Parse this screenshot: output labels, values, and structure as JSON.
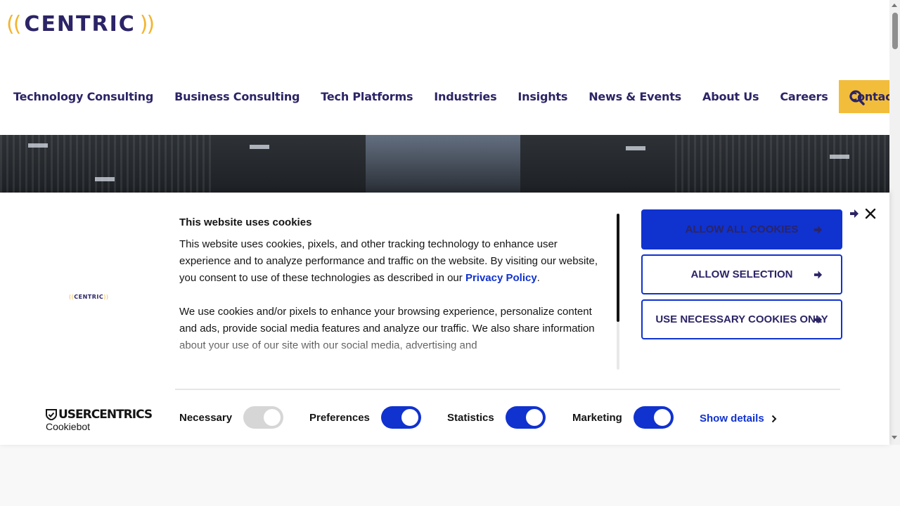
{
  "header": {
    "logo": {
      "left_paren": "((",
      "word": "CENTRIC",
      "right_paren": "))"
    },
    "nav": [
      {
        "label": "Technology Consulting"
      },
      {
        "label": "Business Consulting"
      },
      {
        "label": "Tech Platforms"
      },
      {
        "label": "Industries"
      },
      {
        "label": "Insights"
      },
      {
        "label": "News & Events"
      },
      {
        "label": "About Us"
      },
      {
        "label": "Careers"
      },
      {
        "label": "Contact Us"
      }
    ],
    "search_icon": "search-icon"
  },
  "cookie": {
    "title": "This website uses cookies",
    "p1_before": "This website uses cookies, pixels, and other tracking technology to enhance user experience and to analyze performance and traffic on the website. By visiting our website, you consent to use of these technologies as described in our ",
    "p1_link": "Privacy Policy",
    "p1_after": ".",
    "p2": "We use cookies and/or pixels to enhance your browsing experience, personalize content and ads, provide social media features and analyze our traffic. We also share information about your use of our site with our social media, advertising and",
    "buttons": {
      "allow_all": "ALLOW ALL COOKIES",
      "allow_selection": "ALLOW SELECTION",
      "necessary_only": "USE NECESSARY COOKIES ONLY"
    },
    "toggles": {
      "necessary": "Necessary",
      "preferences": "Preferences",
      "statistics": "Statistics",
      "marketing": "Marketing"
    },
    "show_details": "Show details",
    "provider": {
      "brand": "USERCENTRICS",
      "sub": "Cookiebot"
    }
  },
  "colors": {
    "brand_navy": "#2b2466",
    "brand_gold": "#f2b531",
    "accent_blue": "#1032cf"
  }
}
